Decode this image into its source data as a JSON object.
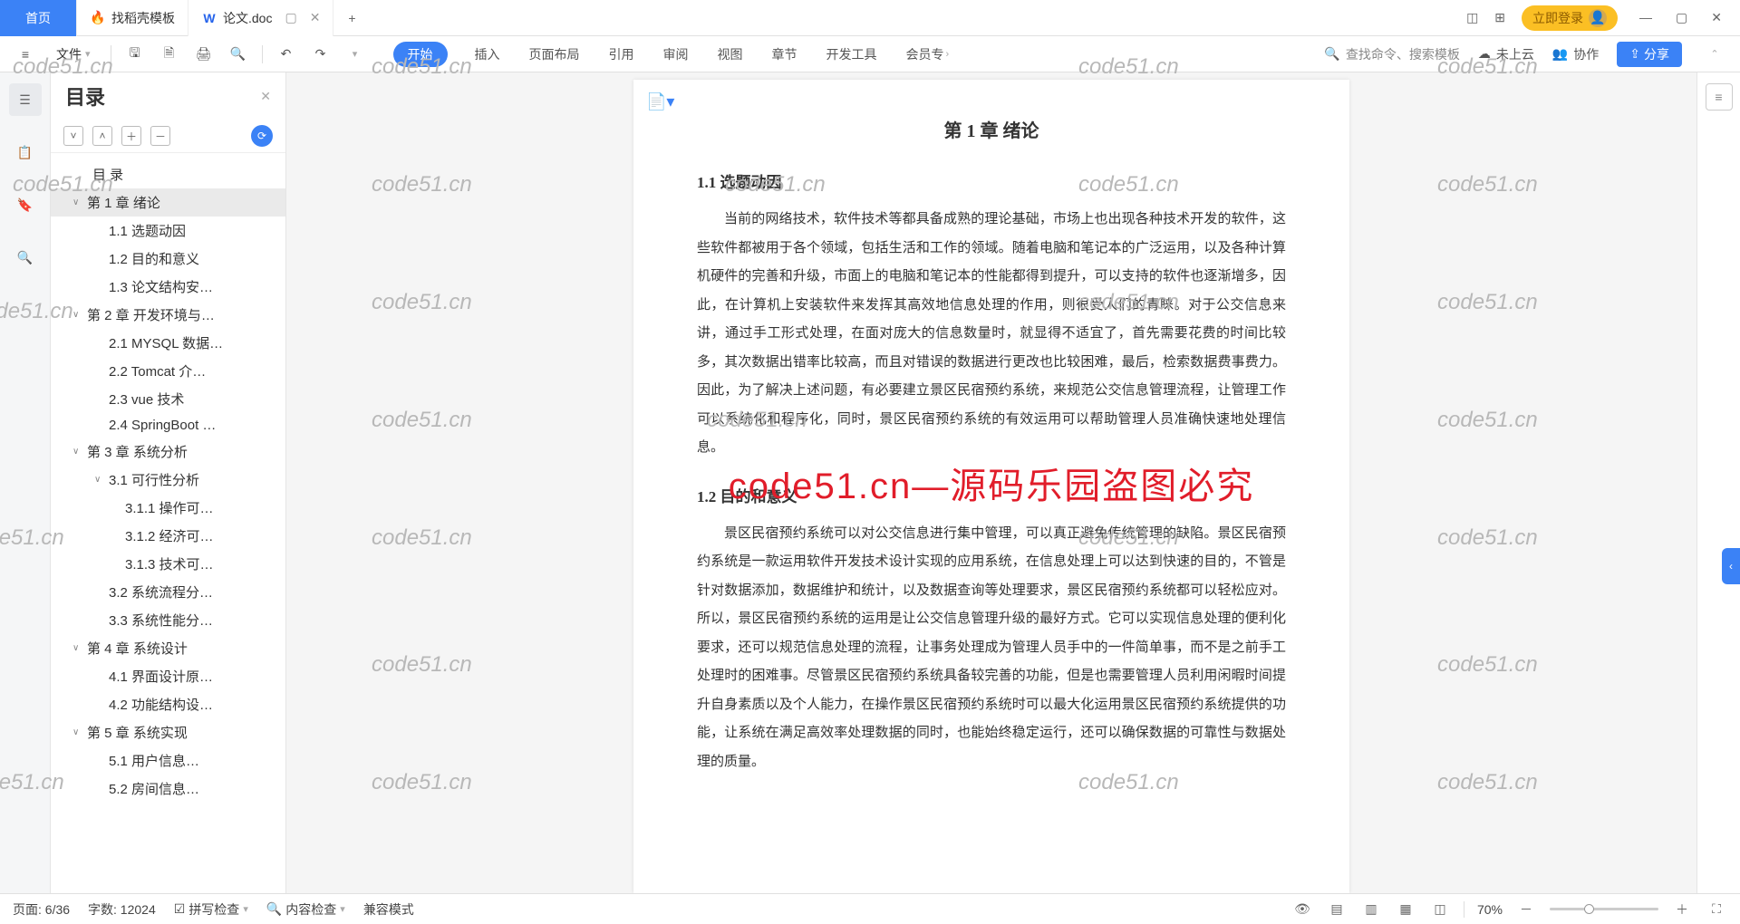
{
  "title_bar": {
    "home_tab": "首页",
    "template_tab": "找稻壳模板",
    "doc_tab": "论文.doc",
    "add_tab": "+",
    "login": "立即登录"
  },
  "ribbon": {
    "file": "文件",
    "tabs": [
      "开始",
      "插入",
      "页面布局",
      "引用",
      "审阅",
      "视图",
      "章节",
      "开发工具"
    ],
    "vip_tab": "会员专",
    "search_placeholder": "查找命令、搜索模板",
    "cloud": "未上云",
    "collab": "协作",
    "share": "分享"
  },
  "outline": {
    "title": "目录",
    "items": [
      {
        "lvl": 0,
        "caret": "",
        "label": "目 录"
      },
      {
        "lvl": 1,
        "caret": "∨",
        "label": "第 1 章  绪论",
        "active": true
      },
      {
        "lvl": 2,
        "caret": "",
        "label": "1.1 选题动因"
      },
      {
        "lvl": 2,
        "caret": "",
        "label": "1.2 目的和意义"
      },
      {
        "lvl": 2,
        "caret": "",
        "label": "1.3 论文结构安…"
      },
      {
        "lvl": 1,
        "caret": "∨",
        "label": "第 2 章  开发环境与…"
      },
      {
        "lvl": 2,
        "caret": "",
        "label": "2.1 MYSQL 数据…"
      },
      {
        "lvl": 2,
        "caret": "",
        "label": "2.2 Tomcat  介…"
      },
      {
        "lvl": 2,
        "caret": "",
        "label": "2.3 vue 技术"
      },
      {
        "lvl": 2,
        "caret": "",
        "label": "2.4 SpringBoot …"
      },
      {
        "lvl": 1,
        "caret": "∨",
        "label": "第 3 章  系统分析"
      },
      {
        "lvl": 2,
        "caret": "∨",
        "label": "3.1 可行性分析"
      },
      {
        "lvl": 3,
        "caret": "",
        "label": "3.1.1 操作可…"
      },
      {
        "lvl": 3,
        "caret": "",
        "label": "3.1.2 经济可…"
      },
      {
        "lvl": 3,
        "caret": "",
        "label": "3.1.3 技术可…"
      },
      {
        "lvl": 2,
        "caret": "",
        "label": "3.2 系统流程分…"
      },
      {
        "lvl": 2,
        "caret": "",
        "label": "3.3 系统性能分…"
      },
      {
        "lvl": 1,
        "caret": "∨",
        "label": "第 4 章  系统设计"
      },
      {
        "lvl": 2,
        "caret": "",
        "label": "4.1 界面设计原…"
      },
      {
        "lvl": 2,
        "caret": "",
        "label": "4.2 功能结构设…"
      },
      {
        "lvl": 1,
        "caret": "∨",
        "label": "第 5 章  系统实现"
      },
      {
        "lvl": 2,
        "caret": "",
        "label": "5.1 用户信息…"
      },
      {
        "lvl": 2,
        "caret": "",
        "label": "5.2 房间信息…"
      }
    ]
  },
  "document": {
    "chapter": "第 1 章  绪论",
    "s1_title": "1.1 选题动因",
    "s1_body": "当前的网络技术，软件技术等都具备成熟的理论基础，市场上也出现各种技术开发的软件，这些软件都被用于各个领域，包括生活和工作的领域。随着电脑和笔记本的广泛运用，以及各种计算机硬件的完善和升级，市面上的电脑和笔记本的性能都得到提升，可以支持的软件也逐渐增多，因此，在计算机上安装软件来发挥其高效地信息处理的作用，则很受人们的青睐。对于公交信息来讲，通过手工形式处理，在面对庞大的信息数量时，就显得不适宜了，首先需要花费的时间比较多，其次数据出错率比较高，而且对错误的数据进行更改也比较困难，最后，检索数据费事费力。因此，为了解决上述问题，有必要建立景区民宿预约系统，来规范公交信息管理流程，让管理工作可以系统化和程序化，同时，景区民宿预约系统的有效运用可以帮助管理人员准确快速地处理信息。",
    "s2_title": "1.2 目的和意义",
    "s2_body": "景区民宿预约系统可以对公交信息进行集中管理，可以真正避免传统管理的缺陷。景区民宿预约系统是一款运用软件开发技术设计实现的应用系统，在信息处理上可以达到快速的目的，不管是针对数据添加，数据维护和统计，以及数据查询等处理要求，景区民宿预约系统都可以轻松应对。所以，景区民宿预约系统的运用是让公交信息管理升级的最好方式。它可以实现信息处理的便利化要求，还可以规范信息处理的流程，让事务处理成为管理人员手中的一件简单事，而不是之前手工处理时的困难事。尽管景区民宿预约系统具备较完善的功能，但是也需要管理人员利用闲暇时间提升自身素质以及个人能力，在操作景区民宿预约系统时可以最大化运用景区民宿预约系统提供的功能，让系统在满足高效率处理数据的同时，也能始终稳定运行，还可以确保数据的可靠性与数据处理的质量。",
    "overlay": "code51.cn—源码乐园盗图必究"
  },
  "status": {
    "page": "页面: 6/36",
    "words": "字数: 12024",
    "spell": "拼写检查",
    "inspect": "内容检查",
    "compat": "兼容模式",
    "zoom": "70%"
  },
  "watermark": "code51.cn"
}
